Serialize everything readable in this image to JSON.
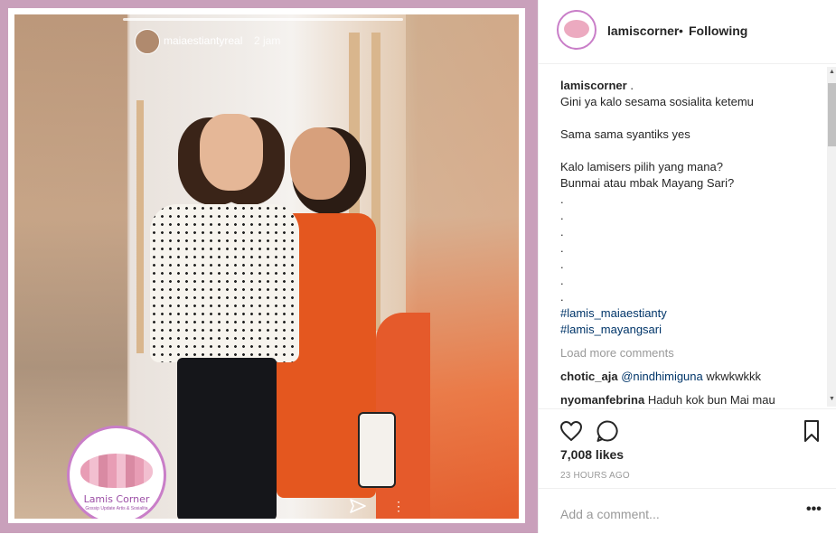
{
  "story": {
    "username": "maiaestiantyreal",
    "time": "2 jam"
  },
  "logo": {
    "title": "Lamis Corner",
    "subtitle": "Gossip Update Artis & Sosialita"
  },
  "header": {
    "username": "lamiscorner",
    "separator": "•",
    "follow_status": "Following"
  },
  "caption": {
    "username": "lamiscorner",
    "suffix": " .",
    "lines": [
      "Gini ya kalo sesama sosialita ketemu",
      "",
      "Sama sama syantiks yes",
      "",
      "Kalo lamisers pilih yang mana?",
      "Bunmai atau mbak Mayang Sari?",
      ".",
      ".",
      ".",
      ".",
      ".",
      ".",
      "."
    ],
    "hashtags": [
      "#lamis_maiaestianty",
      "#lamis_mayangsari"
    ]
  },
  "load_more": "Load more comments",
  "comments": [
    {
      "user": "chotic_aja",
      "mention": "@nindhimiguna",
      "text": "wkwkwkkk"
    },
    {
      "user": "nyomanfebrina",
      "mention": "",
      "text": "Haduh kok bun Mai mau"
    }
  ],
  "likes": "7,008 likes",
  "timestamp": "23 HOURS AGO",
  "add_comment_placeholder": "Add a comment...",
  "icons": {
    "like": "heart-icon",
    "comment": "comment-icon",
    "save": "bookmark-icon",
    "more": "more-options-icon"
  }
}
